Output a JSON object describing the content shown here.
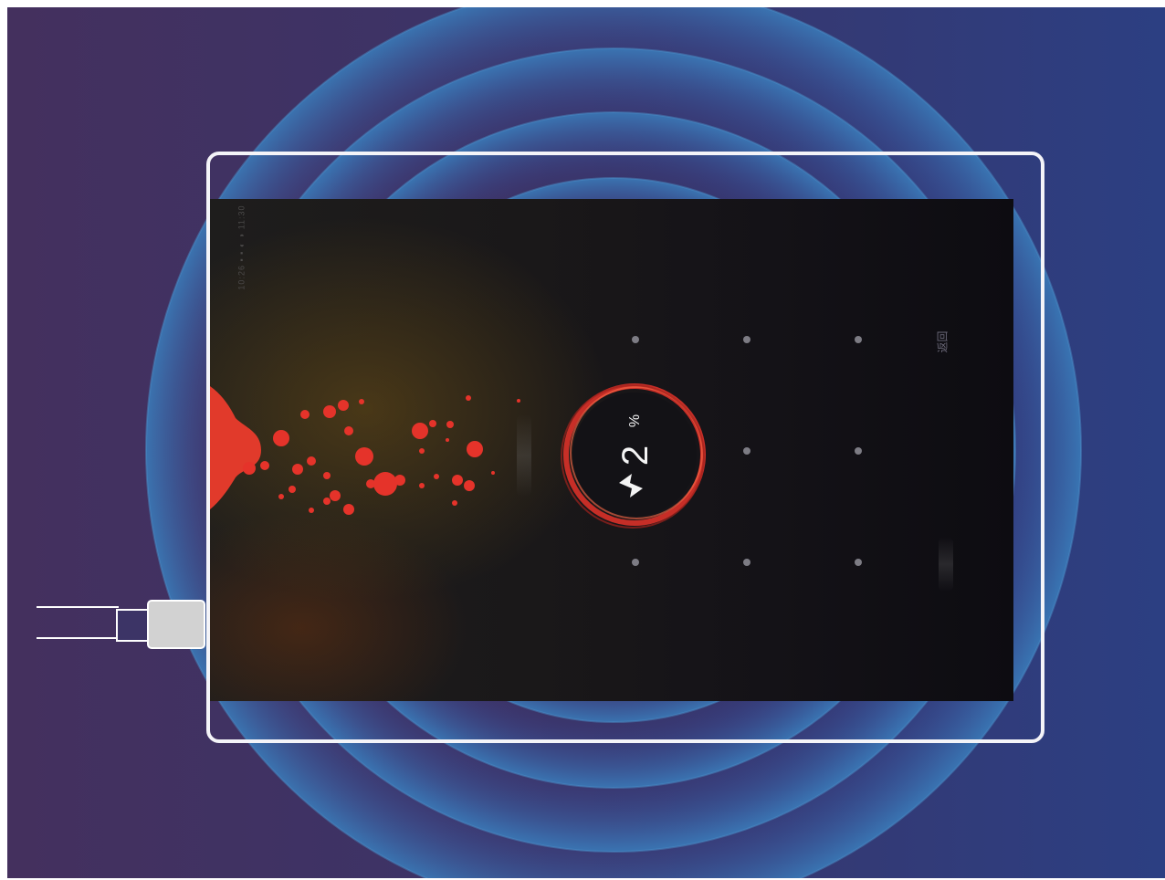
{
  "device": {
    "status_bar": "10:26 ▪ ▪ ◐ ◑ 11:30",
    "back_label": "返回",
    "battery": {
      "percent_value": "2",
      "percent_sign": "%",
      "charging_icon": "lightning-bolt-icon"
    },
    "pattern_dots": 9
  },
  "colors": {
    "accent": "#e5332a",
    "background_left": "#44305e",
    "background_right": "#2c3f82",
    "ring": "#3a72b0"
  }
}
